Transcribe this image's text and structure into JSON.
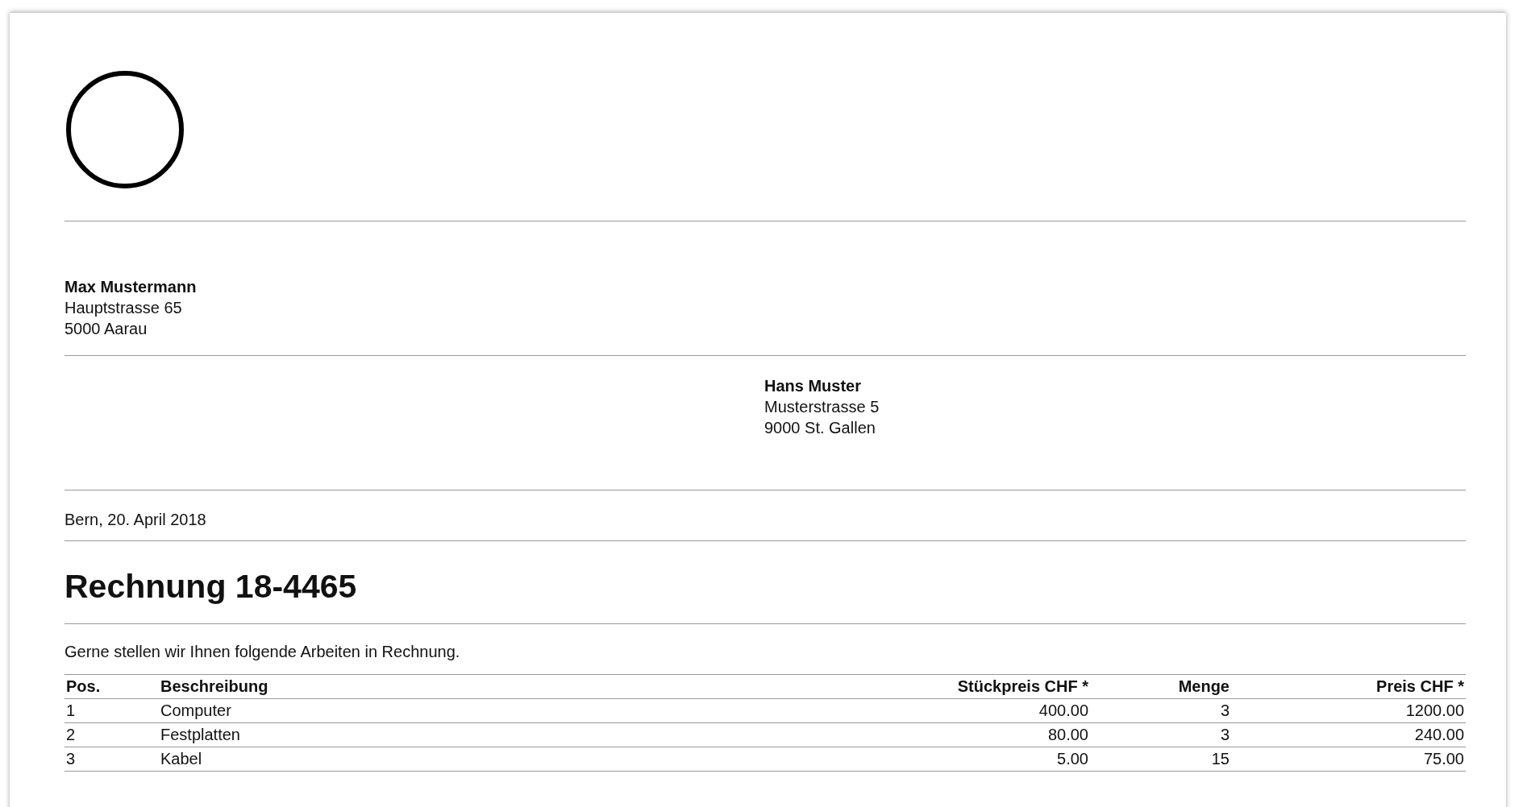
{
  "sender": {
    "name": "Max Mustermann",
    "lines": [
      "Hauptstrasse 65",
      "5000 Aarau"
    ]
  },
  "recipient": {
    "name": "Hans Muster",
    "lines": [
      "Musterstrasse 5",
      "9000 St. Gallen"
    ]
  },
  "date": "Bern, 20. April 2018",
  "title": "Rechnung 18-4465",
  "intro": "Gerne stellen wir Ihnen folgende Arbeiten in Rechnung.",
  "table": {
    "columns": [
      "Pos.",
      "Beschreibung",
      "Stückpreis CHF *",
      "Menge",
      "Preis CHF *"
    ],
    "rows": [
      [
        "1",
        "Computer",
        "400.00",
        "3",
        "1200.00"
      ],
      [
        "2",
        "Festplatten",
        "80.00",
        "3",
        "240.00"
      ],
      [
        "3",
        "Kabel",
        "5.00",
        "15",
        "75.00"
      ]
    ]
  }
}
